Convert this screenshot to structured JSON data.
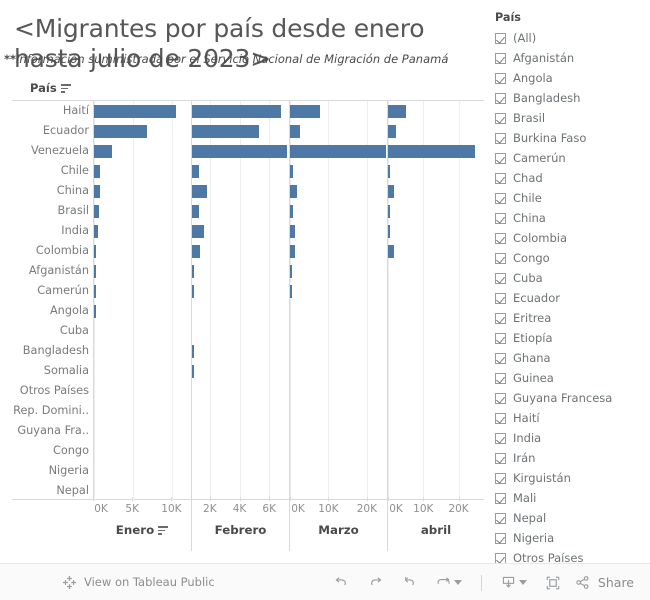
{
  "title": "<Migrantes por país desde enero hasta julio de 2023>",
  "subtitle_bold": "**",
  "subtitle": "Información suministrada por el Servicio Nacional de Migración de Panamá",
  "chart": {
    "row_header": "País",
    "row_header_icon": "sort-icon",
    "panes_sort_icon_on": "Enero"
  },
  "filter": {
    "title": "País",
    "items": [
      {
        "label": "(All)",
        "checked": true
      },
      {
        "label": "Afganistán",
        "checked": true
      },
      {
        "label": "Angola",
        "checked": true
      },
      {
        "label": "Bangladesh",
        "checked": true
      },
      {
        "label": "Brasil",
        "checked": true
      },
      {
        "label": "Burkina Faso",
        "checked": true
      },
      {
        "label": "Camerún",
        "checked": true
      },
      {
        "label": "Chad",
        "checked": true
      },
      {
        "label": "Chile",
        "checked": true
      },
      {
        "label": "China",
        "checked": true
      },
      {
        "label": "Colombia",
        "checked": true
      },
      {
        "label": "Congo",
        "checked": true
      },
      {
        "label": "Cuba",
        "checked": true
      },
      {
        "label": "Ecuador",
        "checked": true
      },
      {
        "label": "Eritrea",
        "checked": true
      },
      {
        "label": "Etiopía",
        "checked": true
      },
      {
        "label": "Ghana",
        "checked": true
      },
      {
        "label": "Guinea",
        "checked": true
      },
      {
        "label": "Guyana Francesa",
        "checked": true
      },
      {
        "label": "Haití",
        "checked": true
      },
      {
        "label": "India",
        "checked": true
      },
      {
        "label": "Irán",
        "checked": true
      },
      {
        "label": "Kirguistán",
        "checked": true
      },
      {
        "label": "Mali",
        "checked": true
      },
      {
        "label": "Nepal",
        "checked": true
      },
      {
        "label": "Nigeria",
        "checked": true
      },
      {
        "label": "Otros Países",
        "checked": true
      }
    ]
  },
  "toolbar": {
    "brand_label": "View on Tableau Public",
    "brand_icon": "tableau-logo-icon",
    "undo_icon": "undo-icon",
    "redo_icon": "redo-icon",
    "revert_icon": "revert-icon",
    "refresh_icon": "refresh-icon",
    "pause_caret_icon": "chevron-down-icon",
    "download_icon": "download-icon",
    "download_caret_icon": "chevron-down-icon",
    "fullscreen_icon": "fullscreen-icon",
    "share_icon": "share-icon",
    "share_label": "Share"
  },
  "chart_data": {
    "type": "bar",
    "title": "<Migrantes por país desde enero hasta julio de 2023>",
    "subtitle": "**Información suministrada por el Servicio Nacional de Migración de Panamá",
    "orientation": "horizontal",
    "ylabel": "País",
    "xlabel": "",
    "grid": true,
    "legend_position": "right",
    "bar_color": "#4e79a7",
    "categories": [
      "Haití",
      "Ecuador",
      "Venezuela",
      "Chile",
      "China",
      "Brasil",
      "India",
      "Colombia",
      "Afganistán",
      "Camerún",
      "Angola",
      "Cuba",
      "Bangladesh",
      "Somalia",
      "Otros Países",
      "Rep. Domini..",
      "Guyana Fra..",
      "Congo",
      "Nigeria",
      "Nepal"
    ],
    "panels": [
      {
        "name": "Enero",
        "sorted": true,
        "xlim": [
          0,
          12500
        ],
        "ticks": [
          0,
          5000,
          10000
        ],
        "ticklabels": [
          "0K",
          "5K",
          "10K"
        ],
        "values": [
          10500,
          6800,
          2300,
          720,
          760,
          600,
          480,
          180,
          190,
          60,
          60,
          0,
          0,
          0,
          0,
          0,
          0,
          0,
          0,
          0
        ]
      },
      {
        "name": "Febrero",
        "sorted": false,
        "xlim": [
          800,
          7400
        ],
        "ticks": [
          2000,
          4000,
          6000
        ],
        "ticklabels": [
          "2K",
          "4K",
          "6K"
        ],
        "values": [
          6800,
          5300,
          7200,
          1300,
          1800,
          1300,
          1600,
          1350,
          900,
          850,
          0,
          0,
          950,
          950,
          0,
          0,
          0,
          0,
          0,
          0
        ]
      },
      {
        "name": "Marzo",
        "sorted": false,
        "xlim": [
          0,
          25500
        ],
        "ticks": [
          0,
          10000,
          20000
        ],
        "ticklabels": [
          "0K",
          "10K",
          "20K"
        ],
        "values": [
          7700,
          2600,
          25000,
          800,
          1900,
          700,
          1300,
          1400,
          200,
          120,
          0,
          0,
          0,
          0,
          0,
          0,
          0,
          0,
          0,
          0
        ]
      },
      {
        "name": "abril",
        "sorted": false,
        "xlim": [
          0,
          27500
        ],
        "ticks": [
          0,
          10000,
          20000
        ],
        "ticklabels": [
          "0K",
          "10K",
          "20K"
        ],
        "values": [
          5200,
          2300,
          24800,
          500,
          1700,
          300,
          300,
          1700,
          0,
          0,
          0,
          0,
          0,
          0,
          0,
          0,
          0,
          0,
          0,
          0
        ]
      }
    ]
  }
}
